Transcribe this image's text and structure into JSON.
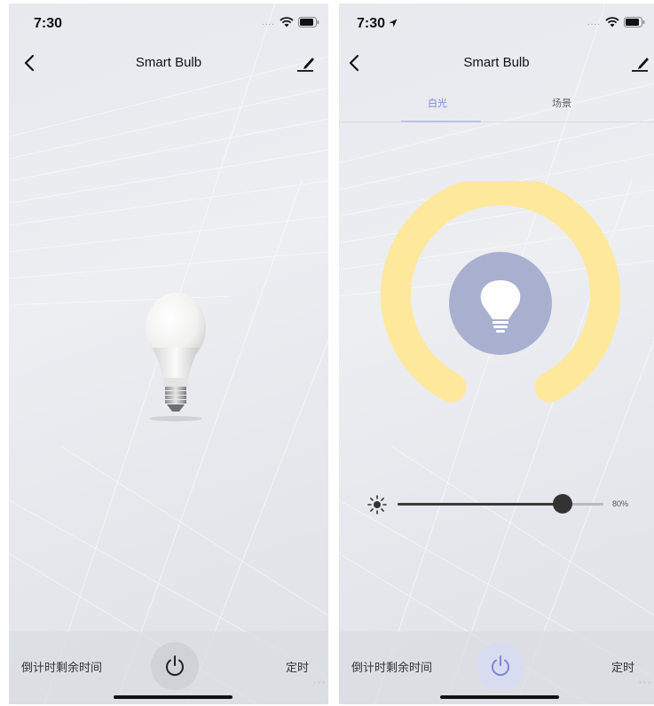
{
  "status_bar": {
    "time": "7:30",
    "signal_dots": "....",
    "icons": [
      "wifi-icon",
      "battery-icon"
    ]
  },
  "status_bar_right": {
    "time": "7:30",
    "icons": [
      "location-arrow-icon",
      "wifi-icon",
      "battery-icon"
    ]
  },
  "nav": {
    "title": "Smart Bulb",
    "back_icon": "chevron-left-icon",
    "edit_icon": "edit-pencil-icon"
  },
  "tabs": [
    {
      "label": "白光",
      "active": true
    },
    {
      "label": "场景",
      "active": false
    }
  ],
  "brightness": {
    "value": 0.8,
    "label": "80%"
  },
  "bottom_bar": {
    "countdown_label": "倒计时剩余时间",
    "timer_label": "定时"
  },
  "colors": {
    "accent": "#7d86d6",
    "ring": "#fde89c",
    "bulb_circle": "#a9b0cf",
    "power_icon_left": "#222222",
    "power_icon_right": "#7d86d6"
  }
}
